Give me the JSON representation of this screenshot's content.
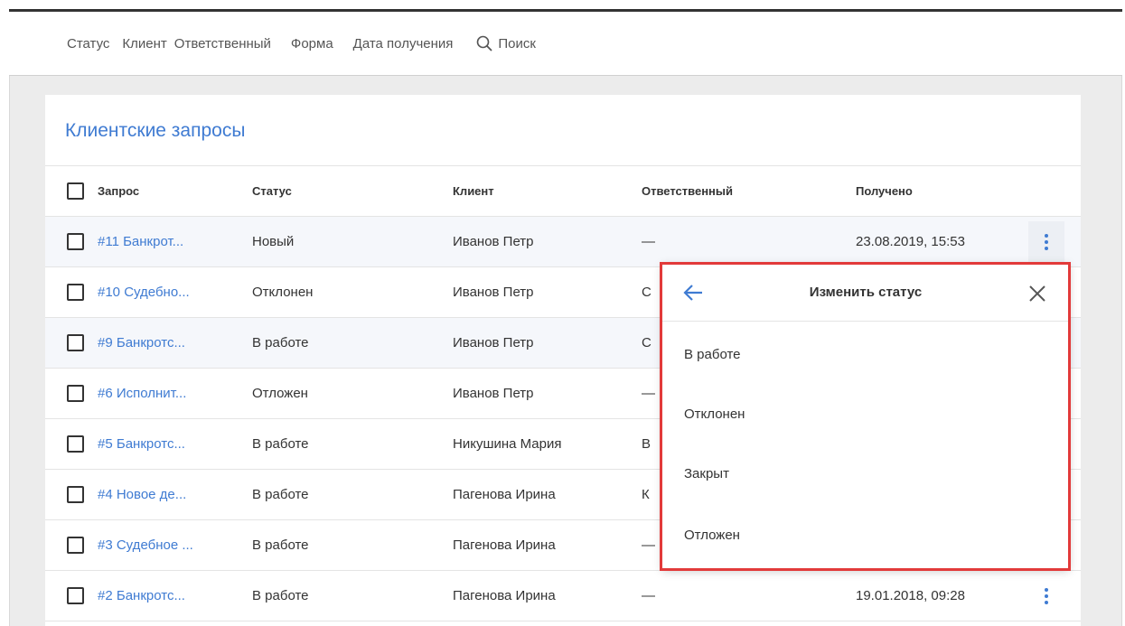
{
  "filters": {
    "items": [
      "Статус",
      "Клиент",
      "Ответственный",
      "Форма",
      "Дата получения"
    ],
    "search": "Поиск"
  },
  "card": {
    "title": "Клиентские запросы",
    "columns": {
      "request": "Запрос",
      "status": "Статус",
      "client": "Клиент",
      "assignee": "Ответственный",
      "received": "Получено"
    },
    "rows": [
      {
        "request": "#11 Банкрот...",
        "status": "Новый",
        "client": "Иванов Петр",
        "assignee": "—",
        "received": "23.08.2019, 15:53"
      },
      {
        "request": "#10 Судебно...",
        "status": "Отклонен",
        "client": "Иванов Петр",
        "assignee": "С",
        "received": ""
      },
      {
        "request": "#9 Банкротс...",
        "status": "В работе",
        "client": "Иванов Петр",
        "assignee": "С",
        "received": ""
      },
      {
        "request": "#6 Исполнит...",
        "status": "Отложен",
        "client": "Иванов Петр",
        "assignee": "—",
        "received": ""
      },
      {
        "request": "#5 Банкротс...",
        "status": "В работе",
        "client": "Никушина Мария",
        "assignee": "В",
        "received": ""
      },
      {
        "request": "#4 Новое де...",
        "status": "В работе",
        "client": "Пагенова Ирина",
        "assignee": "К",
        "received": ""
      },
      {
        "request": "#3 Судебное ...",
        "status": "В работе",
        "client": "Пагенова Ирина",
        "assignee": "—",
        "received": ""
      },
      {
        "request": "#2 Банкротс...",
        "status": "В работе",
        "client": "Пагенова Ирина",
        "assignee": "—",
        "received": "19.01.2018, 09:28"
      }
    ]
  },
  "popup": {
    "title": "Изменить статус",
    "options": [
      "В работе",
      "Отклонен",
      "Закрыт",
      "Отложен"
    ]
  },
  "colors": {
    "accent": "#3f7bd2",
    "highlight": "#e23a3a"
  }
}
